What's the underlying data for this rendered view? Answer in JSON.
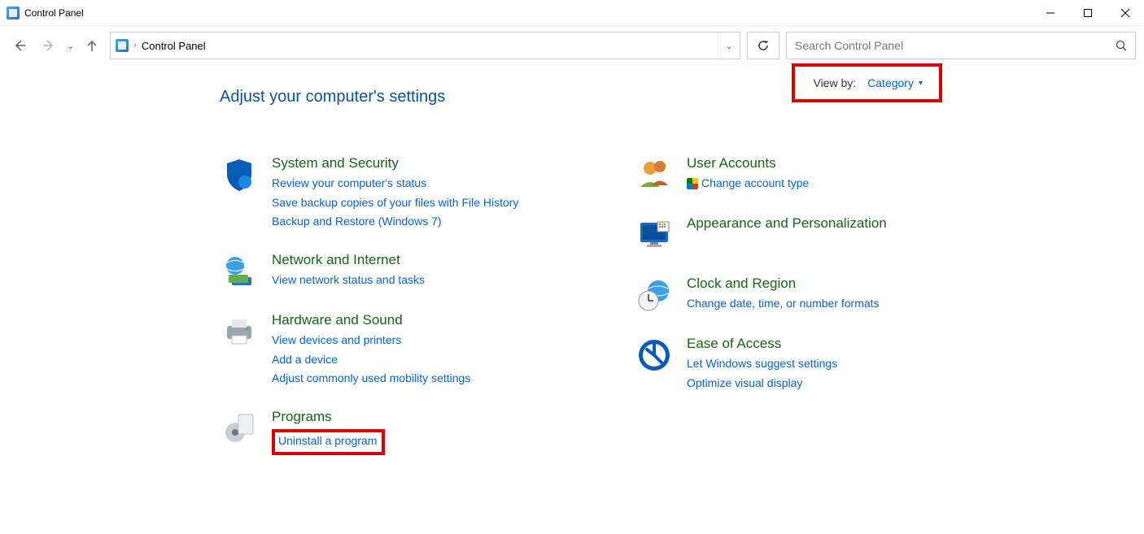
{
  "window": {
    "title": "Control Panel"
  },
  "nav": {
    "breadcrumb": "Control Panel",
    "search_placeholder": "Search Control Panel"
  },
  "header": {
    "title": "Adjust your computer's settings",
    "viewby_label": "View by:",
    "viewby_value": "Category"
  },
  "categories": {
    "system": {
      "title": "System and Security",
      "links": [
        "Review your computer's status",
        "Save backup copies of your files with File History",
        "Backup and Restore (Windows 7)"
      ]
    },
    "network": {
      "title": "Network and Internet",
      "links": [
        "View network status and tasks"
      ]
    },
    "hardware": {
      "title": "Hardware and Sound",
      "links": [
        "View devices and printers",
        "Add a device",
        "Adjust commonly used mobility settings"
      ]
    },
    "programs": {
      "title": "Programs",
      "links": [
        "Uninstall a program"
      ]
    },
    "users": {
      "title": "User Accounts",
      "links": [
        "Change account type"
      ]
    },
    "appearance": {
      "title": "Appearance and Personalization"
    },
    "clock": {
      "title": "Clock and Region",
      "links": [
        "Change date, time, or number formats"
      ]
    },
    "ease": {
      "title": "Ease of Access",
      "links": [
        "Let Windows suggest settings",
        "Optimize visual display"
      ]
    }
  }
}
